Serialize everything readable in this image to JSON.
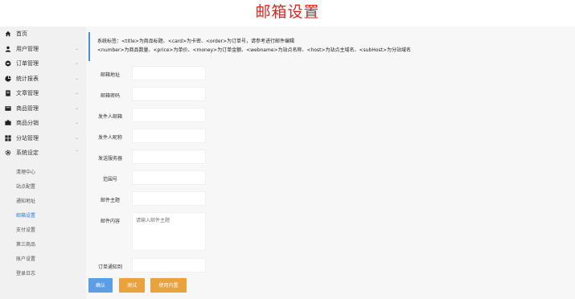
{
  "page": {
    "title": "邮箱设置"
  },
  "sidebar": {
    "items": [
      {
        "label": "首页",
        "icon": "home-icon",
        "chevron": ""
      },
      {
        "label": "用户管理",
        "icon": "user-icon",
        "chevron": "⌄"
      },
      {
        "label": "订单管理",
        "icon": "order-icon",
        "chevron": "⌄"
      },
      {
        "label": "统计报表",
        "icon": "chart-icon",
        "chevron": "⌄"
      },
      {
        "label": "文章管理",
        "icon": "article-icon",
        "chevron": "⌄"
      },
      {
        "label": "商品管理",
        "icon": "product-icon",
        "chevron": "⌄"
      },
      {
        "label": "商品分销",
        "icon": "distribution-icon",
        "chevron": "⌄"
      },
      {
        "label": "分站管理",
        "icon": "substation-icon",
        "chevron": "⌄"
      },
      {
        "label": "系统设定",
        "icon": "gear-icon",
        "chevron": "⌃"
      }
    ],
    "subitems": [
      {
        "label": "清理中心",
        "active": false
      },
      {
        "label": "站点配置",
        "active": false
      },
      {
        "label": "通知地址",
        "active": false
      },
      {
        "label": "邮箱设置",
        "active": true
      },
      {
        "label": "支付设置",
        "active": false
      },
      {
        "label": "第三商品",
        "active": false
      },
      {
        "label": "账户设置",
        "active": false
      },
      {
        "label": "登录日志",
        "active": false
      }
    ]
  },
  "tip": {
    "line1": "系统标签：<title>为商品标题、<card>为卡密、<order>为订单号，请参考进行邮件编辑",
    "line2": "<number>为商品数量、<price>为单价、<money>为订单金额、<webname>为站点名称、<host>为站点主域名、<subHost>为分站域名"
  },
  "form": {
    "fields": [
      {
        "label": "邮箱地址",
        "value": ""
      },
      {
        "label": "邮箱密码",
        "value": ""
      },
      {
        "label": "发件人邮箱",
        "value": ""
      },
      {
        "label": "发件人昵称",
        "value": ""
      },
      {
        "label": "发送服务器",
        "value": ""
      },
      {
        "label": "范围号",
        "value": ""
      },
      {
        "label": "邮件主题",
        "value": ""
      }
    ],
    "content": {
      "label": "邮件内容",
      "placeholder": "请输入邮件主题"
    },
    "notify": {
      "label": "订单通知到",
      "value": ""
    }
  },
  "buttons": {
    "confirm": {
      "label": "确认",
      "color": "#5b9ee6"
    },
    "test": {
      "label": "测试",
      "color": "#e8a23e"
    },
    "use_content": {
      "label": "使用内置",
      "color": "#e8a23e"
    }
  },
  "colors": {
    "title": "#e02424",
    "accent": "#4c8fd6",
    "active_nav": "#2b7be0"
  }
}
